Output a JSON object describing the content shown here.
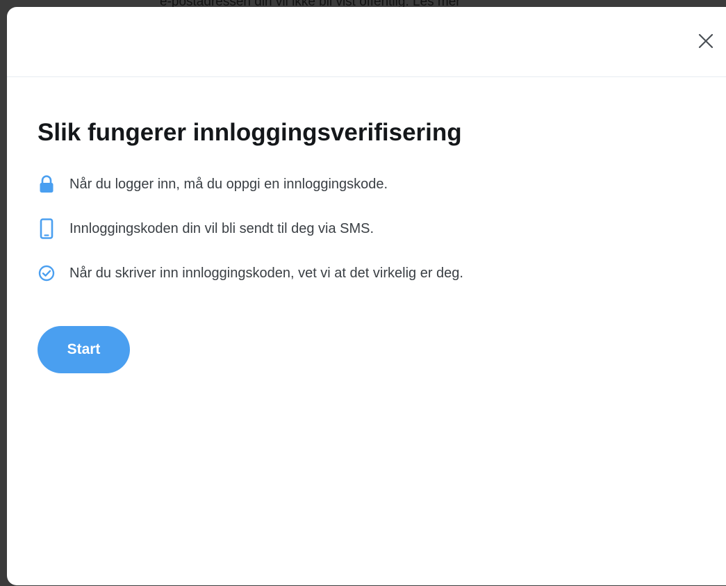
{
  "background": {
    "text": "e-postadressen din vil ikke bli vist offentlig. Les mer"
  },
  "modal": {
    "close_icon": "close-icon",
    "title": "Slik fungerer innloggingsverifisering",
    "items": [
      {
        "icon": "lock-icon",
        "text": "Når du logger inn, må du oppgi en innloggingskode."
      },
      {
        "icon": "phone-icon",
        "text": "Innloggingskoden din vil bli sendt til deg via SMS."
      },
      {
        "icon": "check-circle-icon",
        "text": "Når du skriver inn innloggingskoden, vet vi at det virkelig er deg."
      }
    ],
    "start_label": "Start"
  },
  "colors": {
    "accent": "#4a9ff0",
    "title": "#14171a",
    "body_text": "#3a3f44"
  }
}
